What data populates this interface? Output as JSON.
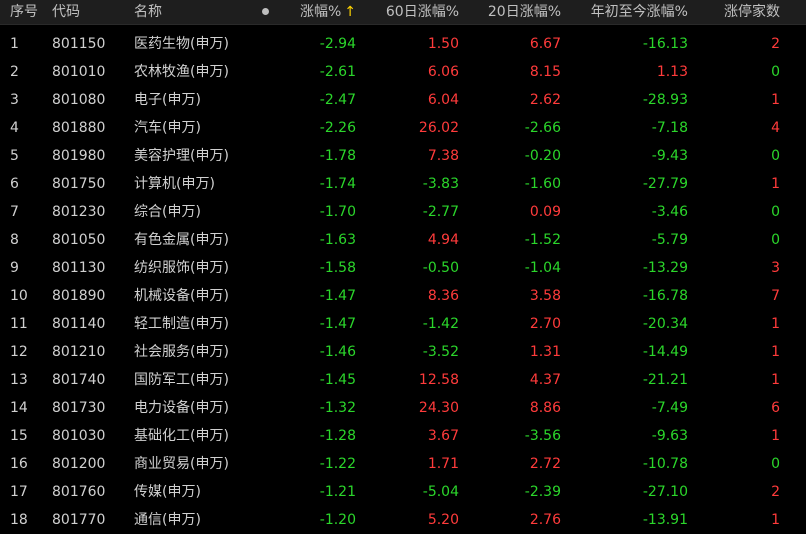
{
  "colors": {
    "background": "#000000",
    "header_bg": "#1e1e1e",
    "up": "#ff3b3b",
    "down": "#2bd62b",
    "arrow": "#ffd400",
    "neutral": "#d0d0d0"
  },
  "header": {
    "seq": "序号",
    "code": "代码",
    "name": "名称",
    "dot_icon": "dot-icon",
    "change": "涨幅%",
    "sort_icon": "↑",
    "change60": "60日涨幅%",
    "change20": "20日涨幅%",
    "ytd": "年初至今涨幅%",
    "limit_up": "涨停家数"
  },
  "rows": [
    {
      "seq": "1",
      "code": "801150",
      "name": "医药生物(申万)",
      "change": "-2.94",
      "change60": "1.50",
      "change20": "6.67",
      "ytd": "-16.13",
      "limit_up": "2"
    },
    {
      "seq": "2",
      "code": "801010",
      "name": "农林牧渔(申万)",
      "change": "-2.61",
      "change60": "6.06",
      "change20": "8.15",
      "ytd": "1.13",
      "limit_up": "0"
    },
    {
      "seq": "3",
      "code": "801080",
      "name": "电子(申万)",
      "change": "-2.47",
      "change60": "6.04",
      "change20": "2.62",
      "ytd": "-28.93",
      "limit_up": "1"
    },
    {
      "seq": "4",
      "code": "801880",
      "name": "汽车(申万)",
      "change": "-2.26",
      "change60": "26.02",
      "change20": "-2.66",
      "ytd": "-7.18",
      "limit_up": "4"
    },
    {
      "seq": "5",
      "code": "801980",
      "name": "美容护理(申万)",
      "change": "-1.78",
      "change60": "7.38",
      "change20": "-0.20",
      "ytd": "-9.43",
      "limit_up": "0"
    },
    {
      "seq": "6",
      "code": "801750",
      "name": "计算机(申万)",
      "change": "-1.74",
      "change60": "-3.83",
      "change20": "-1.60",
      "ytd": "-27.79",
      "limit_up": "1"
    },
    {
      "seq": "7",
      "code": "801230",
      "name": "综合(申万)",
      "change": "-1.70",
      "change60": "-2.77",
      "change20": "0.09",
      "ytd": "-3.46",
      "limit_up": "0"
    },
    {
      "seq": "8",
      "code": "801050",
      "name": "有色金属(申万)",
      "change": "-1.63",
      "change60": "4.94",
      "change20": "-1.52",
      "ytd": "-5.79",
      "limit_up": "0"
    },
    {
      "seq": "9",
      "code": "801130",
      "name": "纺织服饰(申万)",
      "change": "-1.58",
      "change60": "-0.50",
      "change20": "-1.04",
      "ytd": "-13.29",
      "limit_up": "3"
    },
    {
      "seq": "10",
      "code": "801890",
      "name": "机械设备(申万)",
      "change": "-1.47",
      "change60": "8.36",
      "change20": "3.58",
      "ytd": "-16.78",
      "limit_up": "7"
    },
    {
      "seq": "11",
      "code": "801140",
      "name": "轻工制造(申万)",
      "change": "-1.47",
      "change60": "-1.42",
      "change20": "2.70",
      "ytd": "-20.34",
      "limit_up": "1"
    },
    {
      "seq": "12",
      "code": "801210",
      "name": "社会服务(申万)",
      "change": "-1.46",
      "change60": "-3.52",
      "change20": "1.31",
      "ytd": "-14.49",
      "limit_up": "1"
    },
    {
      "seq": "13",
      "code": "801740",
      "name": "国防军工(申万)",
      "change": "-1.45",
      "change60": "12.58",
      "change20": "4.37",
      "ytd": "-21.21",
      "limit_up": "1"
    },
    {
      "seq": "14",
      "code": "801730",
      "name": "电力设备(申万)",
      "change": "-1.32",
      "change60": "24.30",
      "change20": "8.86",
      "ytd": "-7.49",
      "limit_up": "6"
    },
    {
      "seq": "15",
      "code": "801030",
      "name": "基础化工(申万)",
      "change": "-1.28",
      "change60": "3.67",
      "change20": "-3.56",
      "ytd": "-9.63",
      "limit_up": "1"
    },
    {
      "seq": "16",
      "code": "801200",
      "name": "商业贸易(申万)",
      "change": "-1.22",
      "change60": "1.71",
      "change20": "2.72",
      "ytd": "-10.78",
      "limit_up": "0"
    },
    {
      "seq": "17",
      "code": "801760",
      "name": "传媒(申万)",
      "change": "-1.21",
      "change60": "-5.04",
      "change20": "-2.39",
      "ytd": "-27.10",
      "limit_up": "2"
    },
    {
      "seq": "18",
      "code": "801770",
      "name": "通信(申万)",
      "change": "-1.20",
      "change60": "5.20",
      "change20": "2.76",
      "ytd": "-13.91",
      "limit_up": "1"
    }
  ]
}
